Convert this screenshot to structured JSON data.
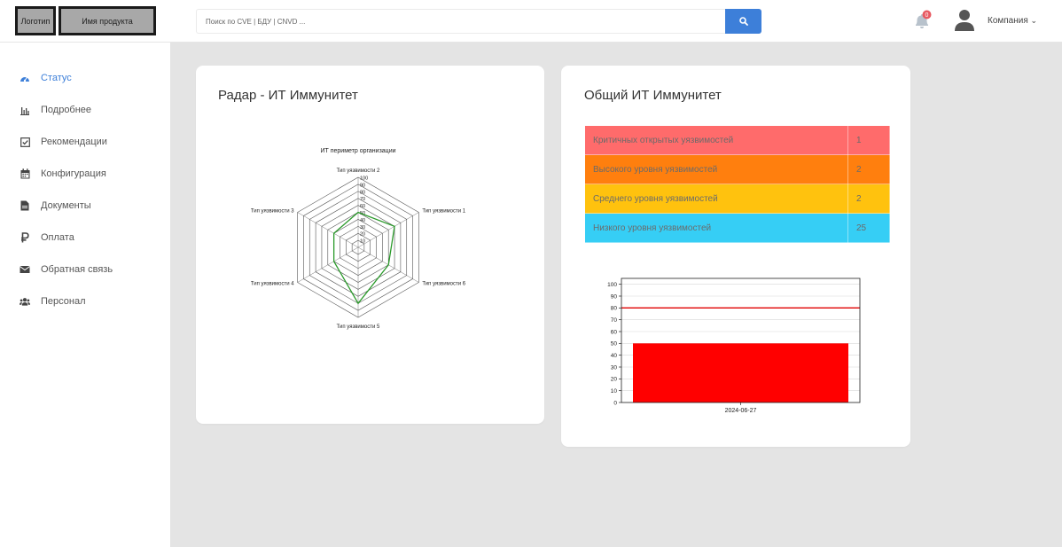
{
  "header": {
    "logo_label": "Логотип",
    "product_label": "Имя продукта",
    "search_placeholder": "Поиск по CVE | БДУ | CNVD ...",
    "search_icon": "search-icon",
    "notifications_count": "0",
    "company_label": "Компания",
    "company_chevron": "⌄"
  },
  "sidebar": {
    "items": [
      {
        "label": "Статус",
        "icon": "dashboard-icon",
        "active": true
      },
      {
        "label": "Подробнее",
        "icon": "bar-chart-icon"
      },
      {
        "label": "Рекомендации",
        "icon": "checkbox-icon"
      },
      {
        "label": "Конфигурация",
        "icon": "calendar-icon"
      },
      {
        "label": "Документы",
        "icon": "document-icon"
      },
      {
        "label": "Оплата",
        "icon": "ruble-icon"
      },
      {
        "label": "Обратная связь",
        "icon": "envelope-icon"
      },
      {
        "label": "Персонал",
        "icon": "users-icon"
      }
    ]
  },
  "radar_card": {
    "title": "Радар - ИТ Иммунитет"
  },
  "immunity_card": {
    "title": "Общий ИТ Иммунитет",
    "rows": [
      {
        "label": "Критичных открытых уязвимостей",
        "value": "1",
        "color": "#ff6b6b"
      },
      {
        "label": "Высокого уровня уязвимостей",
        "value": "2",
        "color": "#ff7f0e"
      },
      {
        "label": "Среднего уровня уязвимостей",
        "value": "2",
        "color": "#ffc20e"
      },
      {
        "label": "Низкого уровня уязвимостей",
        "value": "25",
        "color": "#36cef5"
      }
    ]
  },
  "chart_data": [
    {
      "type": "radar",
      "title": "ИТ периметр организации",
      "axes": [
        "Тип уязвимости 1",
        "Тип уязвимости 2",
        "Тип уязвимости 3",
        "Тип уязвимости 4",
        "Тип уязвимости 5",
        "Тип уязвимости 6"
      ],
      "values": [
        60,
        50,
        40,
        40,
        80,
        50
      ],
      "rlim": [
        0,
        100
      ],
      "rticks": [
        10,
        20,
        30,
        40,
        50,
        60,
        70,
        80,
        90,
        100
      ],
      "series_color": "#2a9a2a",
      "grid_color": "#555555"
    },
    {
      "type": "bar",
      "categories": [
        "2024-06-27"
      ],
      "values": [
        50
      ],
      "ylim": [
        0,
        105
      ],
      "yticks": [
        0,
        10,
        20,
        30,
        40,
        50,
        60,
        70,
        80,
        90,
        100
      ],
      "threshold": 80,
      "bar_color": "#ff0000",
      "threshold_color": "#e00000",
      "grid": true
    }
  ]
}
